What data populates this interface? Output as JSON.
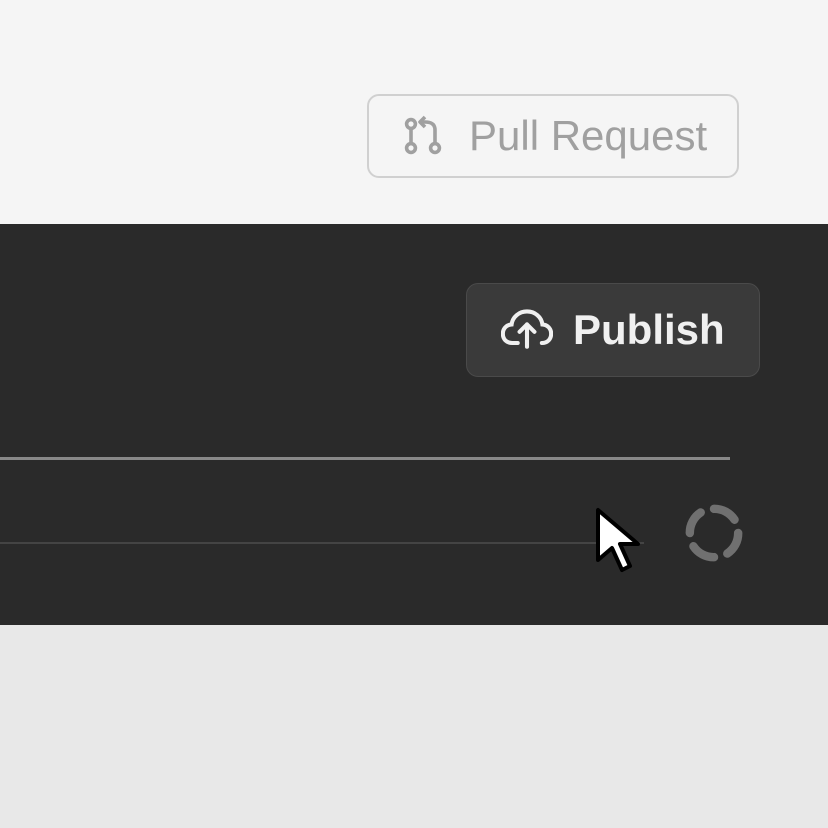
{
  "toolbar": {
    "pull_request_label": "Pull Request",
    "publish_label": "Publish"
  },
  "icons": {
    "git_pull_request": "git-pull-request-icon",
    "cloud_upload": "cloud-upload-icon",
    "spinner": "spinner-icon",
    "cursor": "cursor-icon"
  },
  "colors": {
    "light_bg": "#f5f5f5",
    "dark_bg": "#2a2a2a",
    "button_dark": "#3a3a3a",
    "text_muted": "#a0a0a0",
    "text_light": "#f0f0f0"
  }
}
